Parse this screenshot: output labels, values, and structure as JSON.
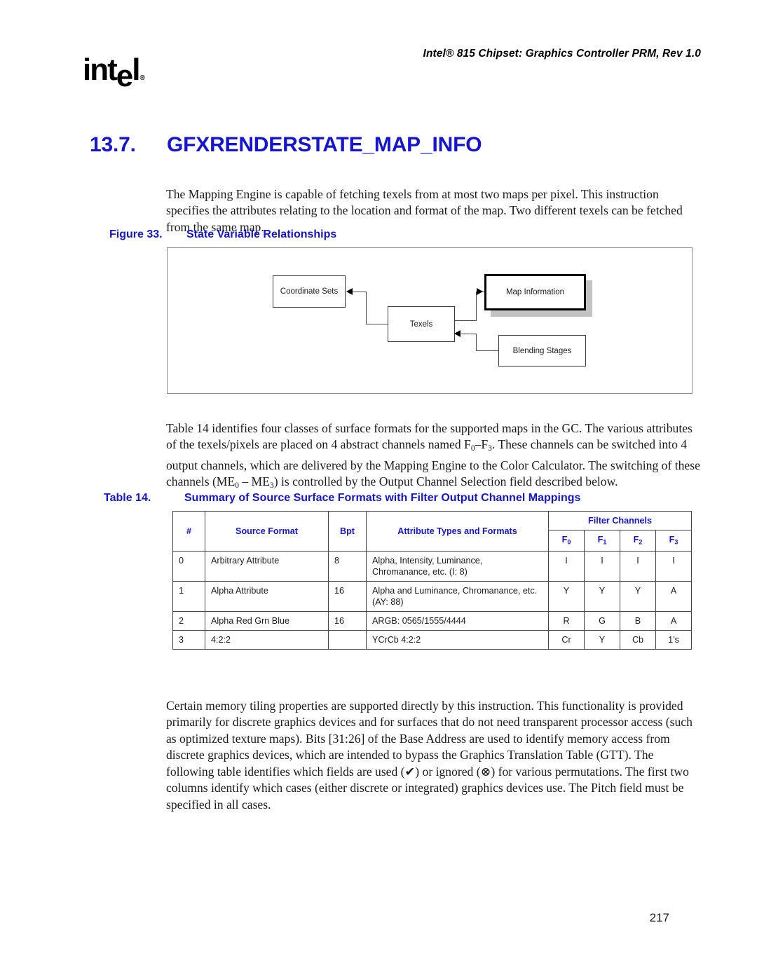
{
  "header": {
    "running_head": "Intel® 815 Chipset: Graphics Controller PRM, Rev 1.0",
    "logo_part1": "int",
    "logo_e": "e",
    "logo_part2": "l",
    "logo_registered": "®"
  },
  "section": {
    "number": "13.7.",
    "title": "GFXRENDERSTATE_MAP_INFO"
  },
  "paragraphs": {
    "intro": "The Mapping Engine is capable of fetching texels from at most two maps per pixel. This instruction specifies the attributes relating to the location and format of the map. Two different texels can be fetched from the same map.",
    "table14_part1": "Table 14 identifies four classes of surface formats for the supported maps in the GC. The various attributes of the texels/pixels are placed on 4 abstract channels named F",
    "table14_sub1": "0",
    "table14_part2": "–F",
    "table14_sub2": "3",
    "table14_part3": ". These channels can be switched into 4 output channels, which are delivered by the Mapping Engine to the Color Calculator. The switching of these channels (ME",
    "table14_sub3": "0",
    "table14_part4": " – ME",
    "table14_sub4": "3",
    "table14_part5": ") is controlled by the Output Channel Selection field described below.",
    "tiling": "Certain memory tiling properties are supported directly by this instruction. This functionality is provided primarily for discrete graphics devices and for surfaces that do not need transparent processor access (such as optimized texture maps). Bits [31:26] of the Base Address are used to identify memory access from discrete graphics devices, which are intended to bypass the Graphics Translation Table (GTT). The following table identifies which fields are used (✔) or ignored (⊗) for various permutations. The first two columns identify which cases (either discrete or integrated) graphics devices use. The Pitch field must be specified in all cases."
  },
  "figure": {
    "label": "Figure 33.",
    "title": "State Variable Relationships",
    "nodes": {
      "coordinate_sets": "Coordinate Sets",
      "texels": "Texels",
      "map_information": "Map Information",
      "blending_stages": "Blending Stages"
    }
  },
  "table": {
    "label": "Table 14.",
    "title": "Summary of Source Surface Formats with Filter Output Channel Mappings",
    "headers": {
      "num": "#",
      "source_format": "Source Format",
      "bpt": "Bpt",
      "attribute": "Attribute Types and Formats",
      "filter_channels": "Filter Channels",
      "f0": "F",
      "f0_sub": "0",
      "f1": "F",
      "f1_sub": "1",
      "f2": "F",
      "f2_sub": "2",
      "f3": "F",
      "f3_sub": "3"
    },
    "rows": [
      {
        "num": "0",
        "source_format": "Arbitrary Attribute",
        "bpt": "8",
        "attribute": "Alpha, Intensity, Luminance, Chromanance, etc. (I: 8)",
        "f0": "I",
        "f1": "I",
        "f2": "I",
        "f3": "I"
      },
      {
        "num": "1",
        "source_format": "Alpha Attribute",
        "bpt": "16",
        "attribute": "Alpha and Luminance, Chromanance, etc. (AY: 88)",
        "f0": "Y",
        "f1": "Y",
        "f2": "Y",
        "f3": "A"
      },
      {
        "num": "2",
        "source_format": "Alpha Red Grn Blue",
        "bpt": "16",
        "attribute": "ARGB: 0565/1555/4444",
        "f0": "R",
        "f1": "G",
        "f2": "B",
        "f3": "A"
      },
      {
        "num": "3",
        "source_format": "4:2:2",
        "bpt": "",
        "attribute": "YCrCb 4:2:2",
        "f0": "Cr",
        "f1": "Y",
        "f2": "Cb",
        "f3": "1’s"
      }
    ]
  },
  "footer": {
    "page_number": "217"
  },
  "colors": {
    "heading_blue": "#1414d2",
    "shadow_gray": "#c2c2c2",
    "border_gray": "#8a8a8a"
  }
}
